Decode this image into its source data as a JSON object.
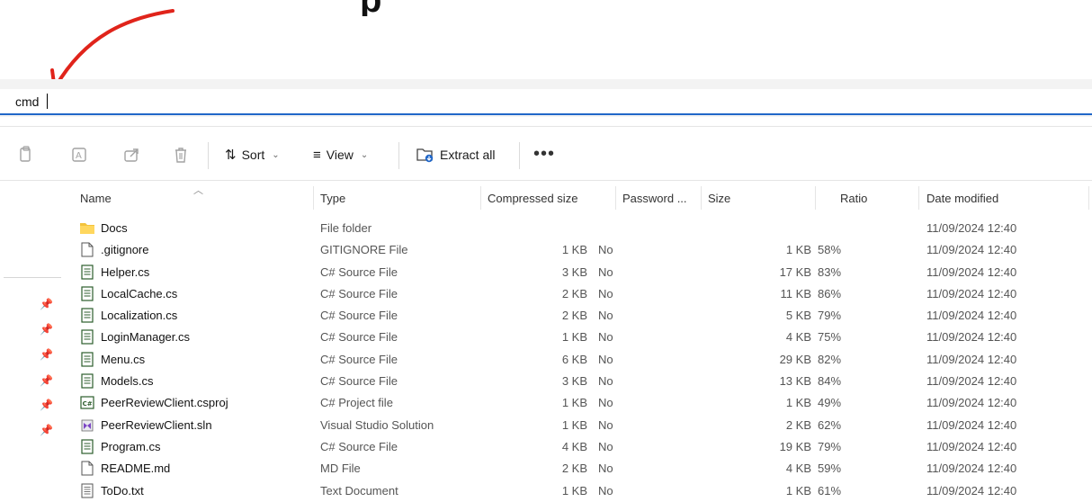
{
  "address_bar": {
    "value": "cmd"
  },
  "toolbar": {
    "sort_label": "Sort",
    "view_label": "View",
    "extract_label": "Extract all",
    "more_label": "•••"
  },
  "columns": {
    "name": "Name",
    "type": "Type",
    "compressed": "Compressed size",
    "password": "Password ...",
    "size": "Size",
    "ratio": "Ratio",
    "date": "Date modified"
  },
  "files": [
    {
      "name": "Docs",
      "type": "File folder",
      "compressed": "",
      "password": "",
      "size": "",
      "ratio": "",
      "date": "11/09/2024 12:40",
      "icon": "folder-icon"
    },
    {
      "name": ".gitignore",
      "type": "GITIGNORE File",
      "compressed": "1 KB",
      "password": "No",
      "size": "1 KB",
      "ratio": "58%",
      "date": "11/09/2024 12:40",
      "icon": "blank-file-icon"
    },
    {
      "name": "Helper.cs",
      "type": "C# Source File",
      "compressed": "3 KB",
      "password": "No",
      "size": "17 KB",
      "ratio": "83%",
      "date": "11/09/2024 12:40",
      "icon": "source-file-icon"
    },
    {
      "name": "LocalCache.cs",
      "type": "C# Source File",
      "compressed": "2 KB",
      "password": "No",
      "size": "11 KB",
      "ratio": "86%",
      "date": "11/09/2024 12:40",
      "icon": "source-file-icon"
    },
    {
      "name": "Localization.cs",
      "type": "C# Source File",
      "compressed": "2 KB",
      "password": "No",
      "size": "5 KB",
      "ratio": "79%",
      "date": "11/09/2024 12:40",
      "icon": "source-file-icon"
    },
    {
      "name": "LoginManager.cs",
      "type": "C# Source File",
      "compressed": "1 KB",
      "password": "No",
      "size": "4 KB",
      "ratio": "75%",
      "date": "11/09/2024 12:40",
      "icon": "source-file-icon"
    },
    {
      "name": "Menu.cs",
      "type": "C# Source File",
      "compressed": "6 KB",
      "password": "No",
      "size": "29 KB",
      "ratio": "82%",
      "date": "11/09/2024 12:40",
      "icon": "source-file-icon"
    },
    {
      "name": "Models.cs",
      "type": "C# Source File",
      "compressed": "3 KB",
      "password": "No",
      "size": "13 KB",
      "ratio": "84%",
      "date": "11/09/2024 12:40",
      "icon": "source-file-icon"
    },
    {
      "name": "PeerReviewClient.csproj",
      "type": "C# Project file",
      "compressed": "1 KB",
      "password": "No",
      "size": "1 KB",
      "ratio": "49%",
      "date": "11/09/2024 12:40",
      "icon": "csproj-file-icon"
    },
    {
      "name": "PeerReviewClient.sln",
      "type": "Visual Studio Solution",
      "compressed": "1 KB",
      "password": "No",
      "size": "2 KB",
      "ratio": "62%",
      "date": "11/09/2024 12:40",
      "icon": "solution-file-icon"
    },
    {
      "name": "Program.cs",
      "type": "C# Source File",
      "compressed": "4 KB",
      "password": "No",
      "size": "19 KB",
      "ratio": "79%",
      "date": "11/09/2024 12:40",
      "icon": "source-file-icon"
    },
    {
      "name": "README.md",
      "type": "MD File",
      "compressed": "2 KB",
      "password": "No",
      "size": "4 KB",
      "ratio": "59%",
      "date": "11/09/2024 12:40",
      "icon": "blank-file-icon"
    },
    {
      "name": "ToDo.txt",
      "type": "Text Document",
      "compressed": "1 KB",
      "password": "No",
      "size": "1 KB",
      "ratio": "61%",
      "date": "11/09/2024 12:40",
      "icon": "text-file-icon"
    }
  ],
  "colors": {
    "accent": "#2167c8",
    "annotation": "#e0241b",
    "folder": "#f3c33c"
  }
}
